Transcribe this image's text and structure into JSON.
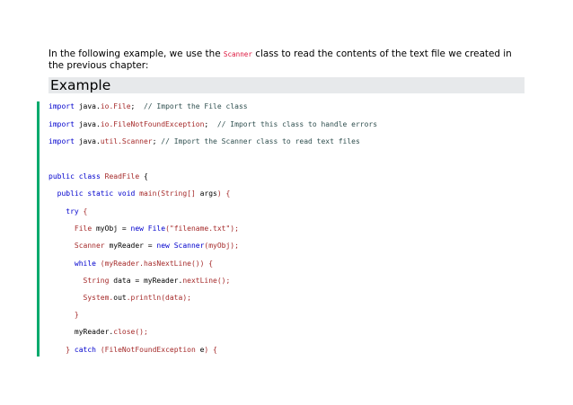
{
  "intro": {
    "before": "In the following example, we use the ",
    "code": "Scanner",
    "after": " class to read the contents of the text file we created in the previous chapter:"
  },
  "example_heading": "Example",
  "code_lines": [
    [
      "import",
      " java.",
      "io.File",
      ";  ",
      "// Import the File class"
    ],
    [
      "import",
      " java.",
      "io.FileNotFoundException",
      ";  ",
      "// Import this class to handle errors"
    ],
    [
      "import",
      " java.",
      "util.Scanner",
      "; ",
      "// Import the Scanner class to read text files"
    ],
    [
      "public class",
      " ",
      "ReadFile",
      " {"
    ],
    [
      "  public static void",
      " ",
      "main",
      "(String[] ",
      "args",
      ") {"
    ],
    [
      "    try",
      " {"
    ],
    [
      "      File",
      " myObj = ",
      "new File",
      "(\"filename.txt\");"
    ],
    [
      "      Scanner",
      " myReader = ",
      "new Scanner",
      "(myObj);"
    ],
    [
      "      while",
      " (myReader.",
      "hasNextLine",
      "()) {"
    ],
    [
      "        String",
      " data = myReader.",
      "nextLine",
      "();"
    ],
    [
      "        System.",
      "out",
      ".println",
      "(data);"
    ],
    [
      "      }"
    ],
    [
      "      myReader.",
      "close",
      "();"
    ],
    [
      "    } ",
      "catch",
      " (FileNotFoundException ",
      "e",
      ") {"
    ]
  ]
}
